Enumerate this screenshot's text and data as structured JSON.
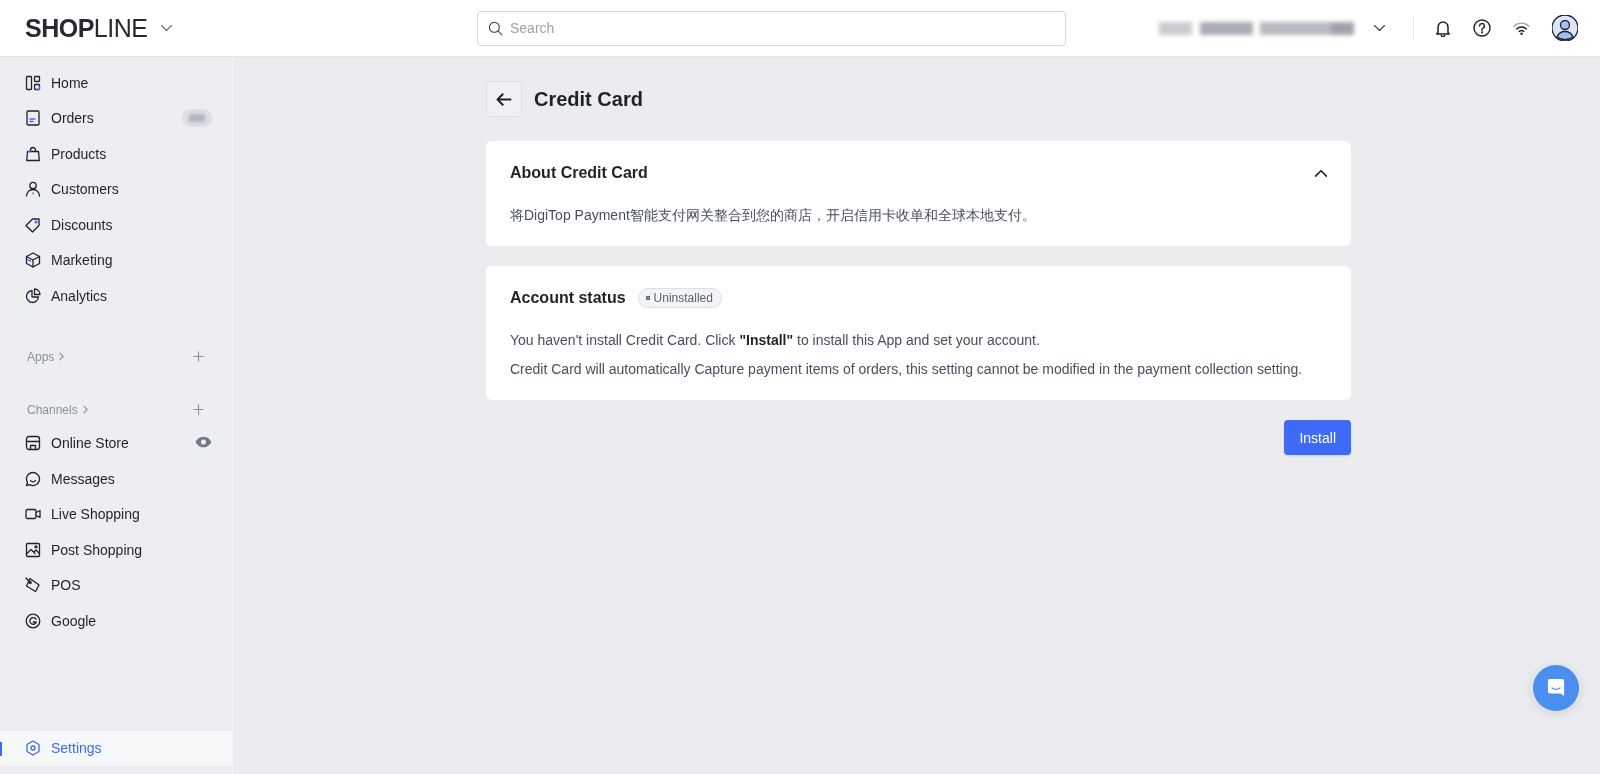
{
  "header": {
    "logo": "**SHOP**LINE",
    "search": {
      "placeholder": "Search"
    }
  },
  "sidebar": {
    "items": [
      {
        "label": "Home",
        "selected": false
      },
      {
        "label": "Orders",
        "selected": false
      },
      {
        "label": "Products",
        "selected": false
      },
      {
        "label": "Customers",
        "selected": false
      },
      {
        "label": "Discounts",
        "selected": false
      },
      {
        "label": "Marketing",
        "selected": false
      },
      {
        "label": "Analytics",
        "selected": false
      }
    ],
    "sections": [
      {
        "title": "Apps"
      },
      {
        "title": "Channels",
        "items": [
          {
            "label": "Online Store",
            "selected": false
          },
          {
            "label": "Messages",
            "selected": false
          },
          {
            "label": "Live Shopping",
            "selected": false
          },
          {
            "label": "Post Shopping",
            "selected": false
          },
          {
            "label": "POS",
            "selected": false
          },
          {
            "label": "Google",
            "selected": false
          }
        ]
      }
    ],
    "settings": {
      "label": "Settings",
      "selected": true
    }
  },
  "page": {
    "title": "Credit Card",
    "cards": [
      {
        "title": "About Credit Card",
        "expanded": true,
        "paragraphs": [
          "将DigiTop Payment智能支付网关整合到您的商店，开启信用卡收单和全球本地支付。"
        ]
      },
      {
        "title": "Account status",
        "status": "Uninstalled",
        "paragraphs": [
          "You haven't install Credit Card. Click **\"Install\"** to install this App and set your account.",
          "Credit Card will automatically Capture payment items of orders, this setting cannot be modified in the payment collection setting."
        ]
      }
    ],
    "action": "Install"
  }
}
